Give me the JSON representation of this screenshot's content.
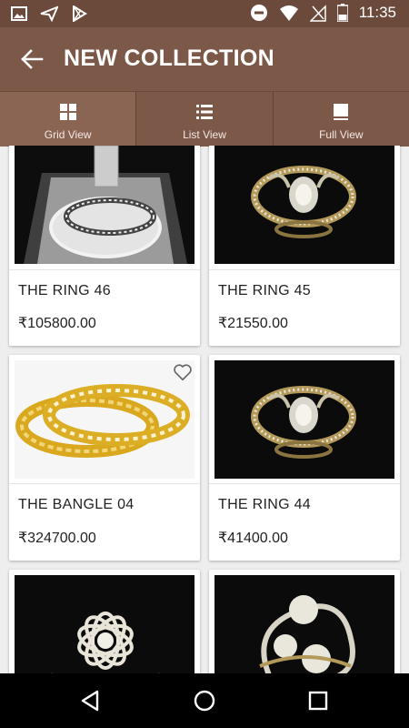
{
  "status_bar": {
    "time": "11:35",
    "left_icons": [
      "image-icon",
      "send-icon",
      "play-store-icon"
    ],
    "right_icons": [
      "do-not-disturb-icon",
      "wifi-icon",
      "no-signal-icon",
      "battery-icon"
    ]
  },
  "toolbar": {
    "title": "NEW COLLECTION",
    "back_icon": "arrow-left-icon"
  },
  "tabs": [
    {
      "label": "Grid View",
      "icon": "grid-icon",
      "active": true
    },
    {
      "label": "List View",
      "icon": "list-icon",
      "active": false
    },
    {
      "label": "Full View",
      "icon": "full-view-icon",
      "active": false
    }
  ],
  "products": [
    {
      "name": "THE RING 46",
      "price": "₹105800.00"
    },
    {
      "name": "THE RING 45",
      "price": "₹21550.00"
    },
    {
      "name": "THE BANGLE 04",
      "price": "₹324700.00"
    },
    {
      "name": "THE RING 44",
      "price": "₹41400.00"
    }
  ],
  "nav_bar": [
    "back-triangle-icon",
    "home-circle-icon",
    "recents-square-icon"
  ],
  "colors": {
    "status_bar": "#6b4a3b",
    "toolbar": "#7b5847",
    "background": "#eeeeee"
  }
}
